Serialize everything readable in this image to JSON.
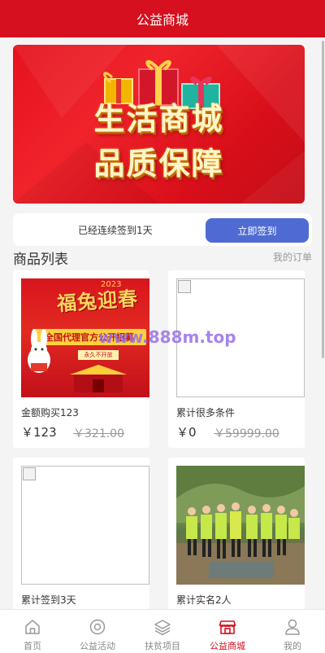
{
  "header": {
    "title": "公益商城"
  },
  "banner": {
    "line1": "生活商城",
    "line2": "品质保障"
  },
  "signin": {
    "status_text": "已经连续签到1天",
    "button_label": "立即签到"
  },
  "products_section": {
    "title": "商品列表",
    "my_orders_label": "我的订单"
  },
  "products": [
    {
      "name": "金额购买123",
      "price": "￥123",
      "original_price": "￥321.00",
      "image": {
        "type": "photo",
        "headline": "福兔迎春",
        "year": "2023",
        "banner_text": "全国代理官方公开招募",
        "sub_text": "永久不开放"
      }
    },
    {
      "name": "累计很多条件",
      "price": "￥0",
      "original_price": "￥59999.00",
      "image": {
        "type": "broken"
      }
    },
    {
      "name": "累计签到3天",
      "image": {
        "type": "broken"
      }
    },
    {
      "name": "累计实名2人",
      "image": {
        "type": "photo"
      }
    }
  ],
  "watermark": "www.888m.top",
  "tabbar": {
    "active": "公益商城",
    "items": [
      {
        "label": "首页",
        "icon": "home-icon"
      },
      {
        "label": "公益活动",
        "icon": "target-icon"
      },
      {
        "label": "扶贫项目",
        "icon": "layers-icon"
      },
      {
        "label": "公益商城",
        "icon": "shop-icon"
      },
      {
        "label": "我的",
        "icon": "user-icon"
      }
    ]
  },
  "colors": {
    "brand": "#d6101e",
    "signin_button": "#4f6bd3",
    "watermark": "#966ee6"
  }
}
